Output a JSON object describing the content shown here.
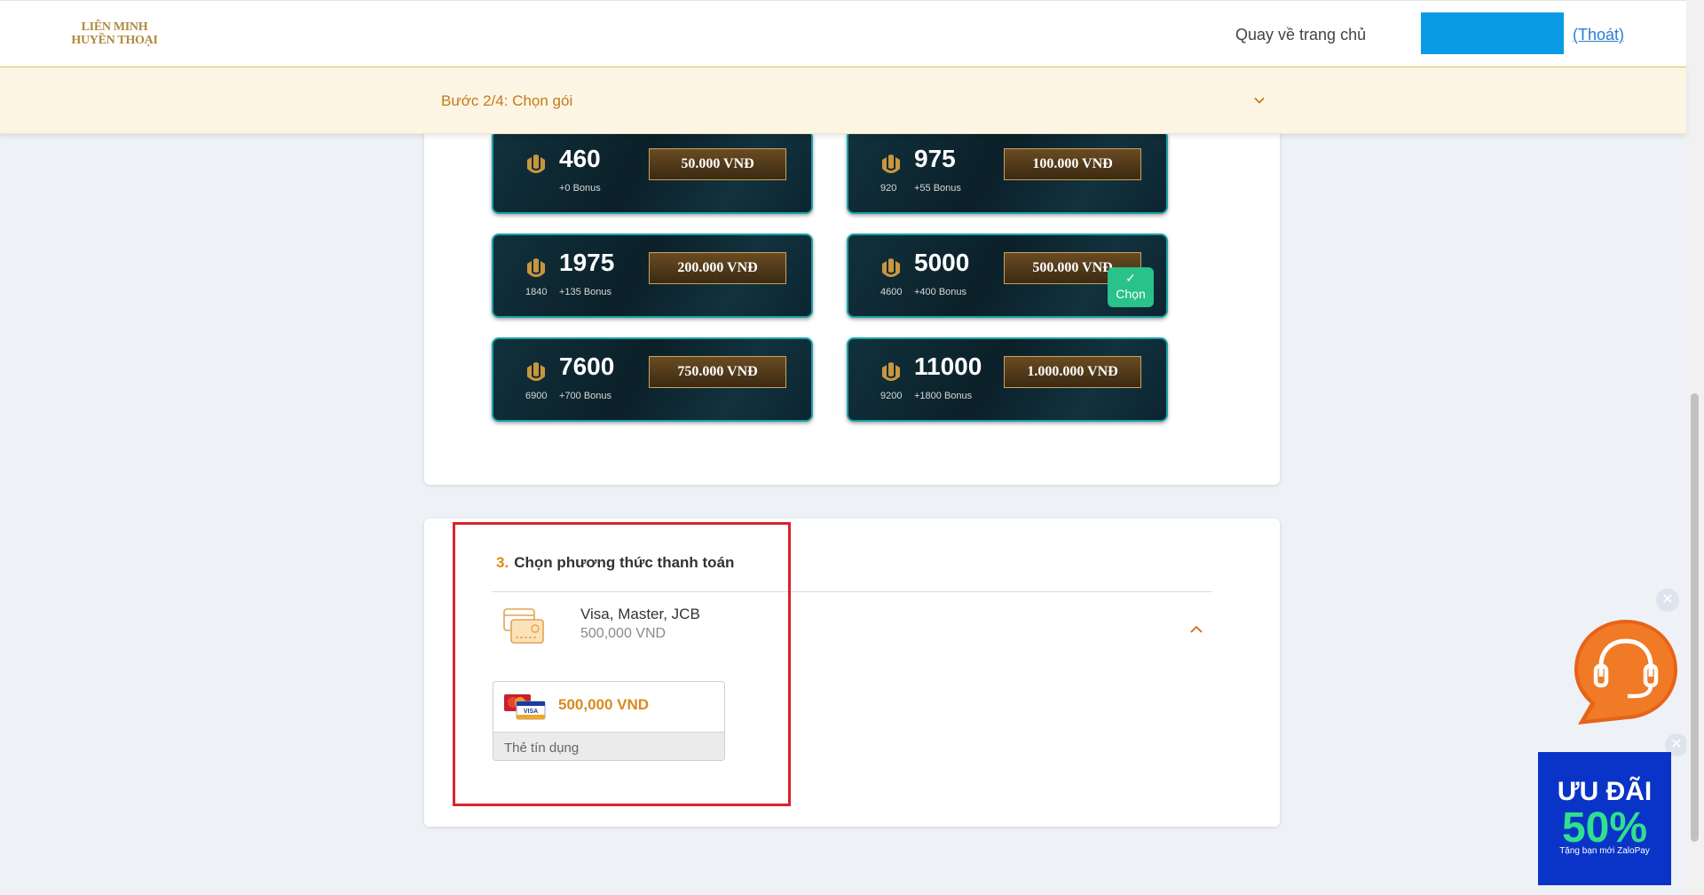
{
  "header": {
    "logo_line1": "LIÊN MINH",
    "logo_line2": "HUYỀN THOẠI",
    "home_link": "Quay về trang chủ",
    "logout_link": "(Thoát)"
  },
  "step_bar": {
    "label": "Bước 2/4: Chọn gói"
  },
  "packages": [
    {
      "rp": "460",
      "base": "",
      "bonus": "+0 Bonus",
      "price": "50.000 VNĐ",
      "selected": false
    },
    {
      "rp": "975",
      "base": "920",
      "bonus": "+55 Bonus",
      "price": "100.000 VNĐ",
      "selected": false
    },
    {
      "rp": "1975",
      "base": "1840",
      "bonus": "+135 Bonus",
      "price": "200.000 VNĐ",
      "selected": false
    },
    {
      "rp": "5000",
      "base": "4600",
      "bonus": "+400 Bonus",
      "price": "500.000 VNĐ",
      "selected": true
    },
    {
      "rp": "7600",
      "base": "6900",
      "bonus": "+700 Bonus",
      "price": "750.000 VNĐ",
      "selected": false
    },
    {
      "rp": "11000",
      "base": "9200",
      "bonus": "+1800 Bonus",
      "price": "1.000.000 VNĐ",
      "selected": false
    }
  ],
  "selected_badge": {
    "check": "✓",
    "label": "Chọn"
  },
  "payment": {
    "step_number": "3.",
    "title": "Chọn phương thức thanh toán",
    "method_name": "Visa, Master, JCB",
    "method_amount": "500,000 VND",
    "option_amount": "500,000 VND",
    "option_label": "Thẻ tín dụng"
  },
  "promo": {
    "line1": "ƯU ĐÃI",
    "line2": "50%",
    "line3": "Tặng bạn mới ZaloPay"
  },
  "colors": {
    "accent": "#e08a16",
    "selected_green": "#28c28a",
    "highlight_red": "#d8232d",
    "header_blue": "#0a9be6"
  }
}
